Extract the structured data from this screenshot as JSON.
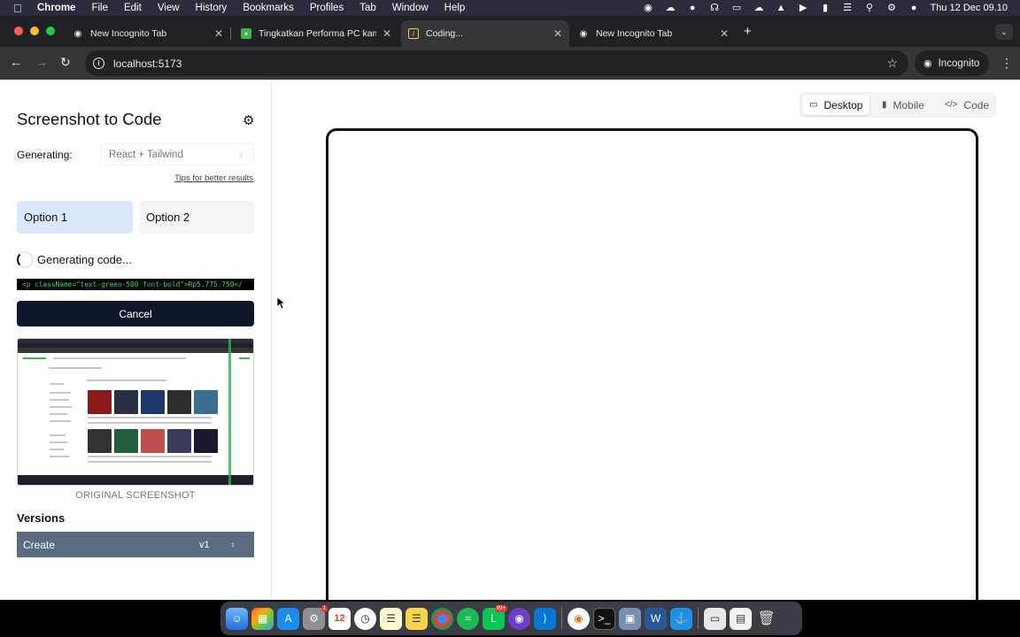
{
  "menubar": {
    "app": "Chrome",
    "items": [
      "File",
      "Edit",
      "View",
      "History",
      "Bookmarks",
      "Profiles",
      "Tab",
      "Window",
      "Help"
    ],
    "clock": "Thu 12 Dec  09.10"
  },
  "browser": {
    "tabs": [
      {
        "label": "New Incognito Tab",
        "icon": "incognito-icon"
      },
      {
        "label": "Tingkatkan Performa PC kamu",
        "icon": "tokopedia-icon"
      },
      {
        "label": "Coding...",
        "icon": "app-icon"
      },
      {
        "label": "New Incognito Tab",
        "icon": "incognito-icon"
      }
    ],
    "url": "localhost:5173",
    "profile_label": "Incognito"
  },
  "sidebar": {
    "title": "Screenshot to Code",
    "generating_label": "Generating:",
    "stack_value": "React + Tailwind",
    "tips_link": "Tips for better results",
    "options": [
      "Option 1",
      "Option 2"
    ],
    "status": "Generating code...",
    "code_preview": "<p className=\"text-green-500 font-bold\">Rp5.775.750</",
    "cancel_label": "Cancel",
    "screenshot_label": "ORIGINAL SCREENSHOT",
    "versions_title": "Versions",
    "version": {
      "label": "Create",
      "number": "v1"
    }
  },
  "view_tabs": [
    {
      "label": "Desktop",
      "icon": "monitor-icon"
    },
    {
      "label": "Mobile",
      "icon": "phone-icon"
    },
    {
      "label": "Code",
      "icon": "code-icon"
    }
  ],
  "dock": {
    "badges": {
      "settings": "1",
      "calendar_day": "12",
      "line": "99+"
    }
  },
  "colors": {
    "accent_dark": "#0f172a",
    "option_selected": "#dbe7fb",
    "version_row": "#5a6b82",
    "code_text": "#3ddc6a"
  }
}
